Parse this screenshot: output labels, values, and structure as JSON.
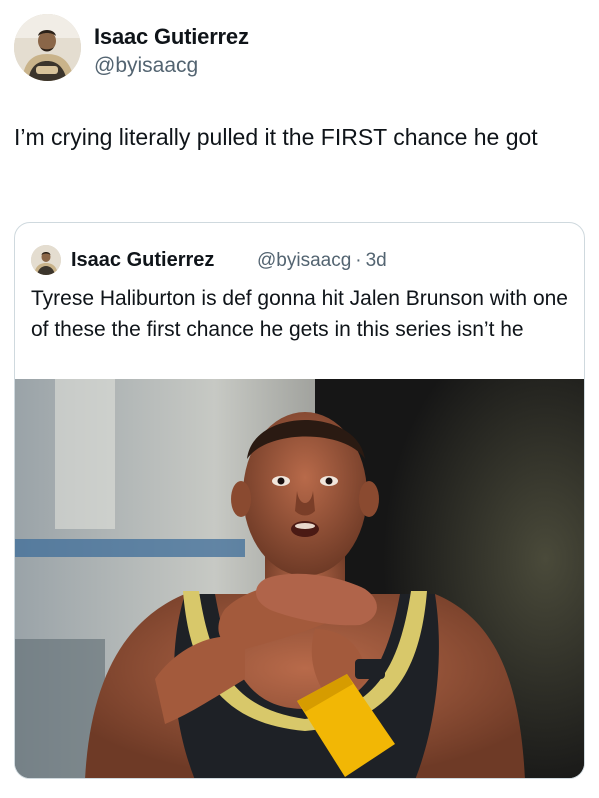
{
  "tweet": {
    "author": {
      "name": "Isaac Gutierrez",
      "handle": "@byisaacg"
    },
    "text": "I’m crying literally pulled it the FIRST chance he got"
  },
  "quoted_tweet": {
    "author": {
      "name": "Isaac Gutierrez",
      "handle": "@byisaacg"
    },
    "separator": "·",
    "age": "3d",
    "text": "Tyrese Haliburton is def gonna hit Jalen Brunson with one of these the first chance he gets in this series isn’t he"
  }
}
